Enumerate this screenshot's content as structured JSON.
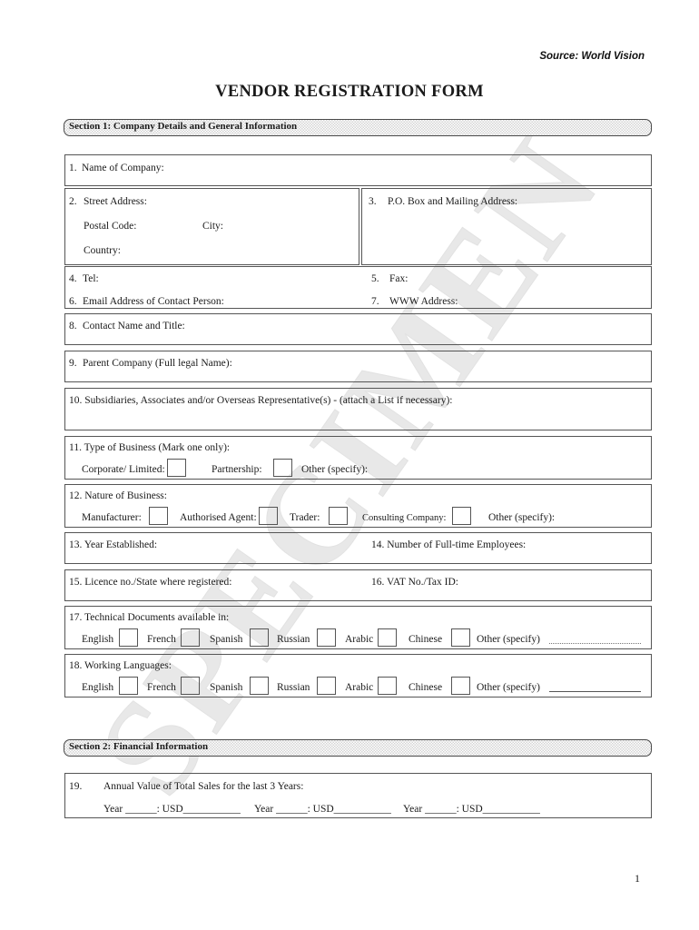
{
  "header": {
    "source": "Source: World Vision",
    "title": "VENDOR REGISTRATION FORM"
  },
  "sections": [
    {
      "label": "Section 1: Company Details and General Information"
    },
    {
      "label": "Section 2: Financial Information"
    }
  ],
  "fields": {
    "f1_num": "1.",
    "f1_label": "Name of Company:",
    "f2_num": "2.",
    "f2_label": "Street Address:",
    "f2_postal": "Postal Code:",
    "f2_city": "City:",
    "f2_country": "Country:",
    "f3_num": "3.",
    "f3_label": "P.O. Box and Mailing Address:",
    "f4_num": "4.",
    "f4_label": "Tel:",
    "f5_num": "5.",
    "f5_label": "Fax:",
    "f6_num": "6.",
    "f6_label": "Email Address of Contact Person:",
    "f7_num": "7.",
    "f7_label": "WWW Address:",
    "f8_num": "8.",
    "f8_label": "Contact Name and Title:",
    "f9_num": "9.",
    "f9_label": "Parent Company (Full legal Name):",
    "f10_label": "10. Subsidiaries, Associates and/or Overseas Representative(s) -  (attach a List if necessary):",
    "f11_label": "11. Type of Business (Mark one only):",
    "f11_opt1": "Corporate/ Limited:",
    "f11_opt2": "Partnership:",
    "f11_opt3": "Other (specify):",
    "f12_label": "12. Nature of Business:",
    "f12_opt1": "Manufacturer:",
    "f12_opt2": "Authorised Agent:",
    "f12_opt3": "Trader:",
    "f12_opt4": "Consulting Company:",
    "f12_opt5": "Other (specify):",
    "f13_label": "13. Year Established:",
    "f14_label": "14. Number of Full-time Employees:",
    "f15_label": "15. Licence no./State where registered:",
    "f16_label": "16. VAT No./Tax ID:",
    "f17_label": "17. Technical Documents available in:",
    "f18_label": "18. Working Languages:",
    "f19_num": "19.",
    "f19_label": "Annual Value of Total Sales for the last 3 Years:",
    "f19_entry1": "Year ______: USD___________",
    "f19_entry2": "Year ______: USD___________",
    "f19_entry3": "Year ______: USD___________"
  },
  "languages": [
    {
      "label": "English"
    },
    {
      "label": "French"
    },
    {
      "label": "Spanish"
    },
    {
      "label": "Russian"
    },
    {
      "label": "Arabic"
    },
    {
      "label": "Chinese"
    }
  ],
  "language_other_label": "Other (specify)",
  "watermark": "SPECIMEN",
  "footer": {
    "page_number": "1"
  },
  "colors": {
    "border": "#555555",
    "section_fill": "#d4d4d4",
    "watermark": "#e8e8e8",
    "text": "#1a1a1a"
  }
}
